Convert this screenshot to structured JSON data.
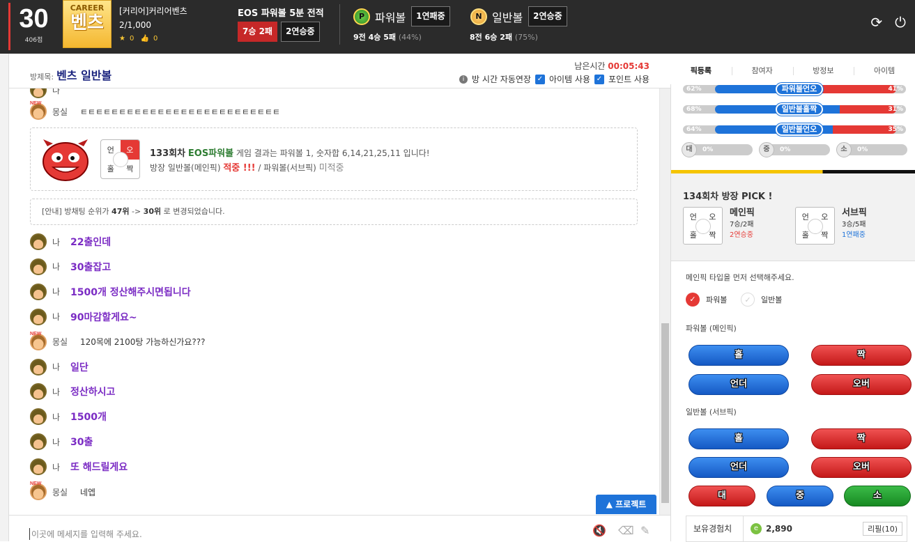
{
  "top": {
    "level": "30",
    "points": "406점",
    "badge_top": "CAREER",
    "badge_main": "벤츠",
    "user_name": "[커리어]커리어벤츠",
    "user_count": "2/1,000",
    "stars": "0",
    "likes": "0",
    "game_title": "EOS 파워볼 5분 전적",
    "record_tag": "7승 2패",
    "streak_tag": "2연승중",
    "powerball": {
      "coin": "P",
      "label": "파워볼",
      "streak": "1연패중",
      "record": "9전 4승 5패",
      "rate": "(44%)"
    },
    "normalball": {
      "coin": "N",
      "label": "일반볼",
      "streak": "2연승중",
      "record": "8전 6승 2패",
      "rate": "(75%)"
    },
    "refresh_icon": "refresh-icon",
    "power_icon": "power-icon"
  },
  "room": {
    "title_label": "방제목:",
    "title": "벤츠 일반볼",
    "remain_label": "남은시간",
    "remain_time": "00:05:43",
    "auto_extend": "방 시간 자동연장",
    "use_item": "아이템 사용",
    "use_point": "포인트 사용"
  },
  "chat": {
    "top_partial_name": "나",
    "m1_name": "몽실",
    "m1_text": "ㅌㅌㅌㅌㅌㅌㅌㅌㅌㅌㅌㅌㅌㅌㅌㅌㅌㅌㅌㅌㅌㅌㅌㅌㅌㅌ",
    "result": {
      "dial": [
        "언",
        "오",
        "홀",
        "짝"
      ],
      "round": "133회차",
      "game": "EOS파워볼",
      "text1": "게임 결과는 파워볼 1, 숫자합 6,14,21,25,11 입니다!",
      "text2a": "방장 일반볼(메인픽)",
      "hit": "적중 !!!",
      "text2b": "/ 파워볼(서브픽)",
      "miss": "미적중"
    },
    "notice_pre": "[안내] 방채팅 순위가",
    "notice_from": "47위",
    "notice_mid": "->",
    "notice_to": "30위",
    "notice_post": "로 변경되었습니다.",
    "messages": [
      {
        "who": "나",
        "text": "22출인데"
      },
      {
        "who": "나",
        "text": "30출잡고"
      },
      {
        "who": "나",
        "text": "1500개 정산해주시면됩니다"
      },
      {
        "who": "나",
        "text": "90마감할게요~"
      },
      {
        "who": "몽실",
        "text": "120목에 2100탕 가능하신가요???"
      },
      {
        "who": "나",
        "text": "일단"
      },
      {
        "who": "나",
        "text": "정산하시고"
      },
      {
        "who": "나",
        "text": "1500개"
      },
      {
        "who": "나",
        "text": "30출"
      },
      {
        "who": "나",
        "text": "또 해드릴게요"
      },
      {
        "who": "몽실",
        "text": "네엡"
      }
    ],
    "new_label": "NEW",
    "protect_label": "▲ 프로젝트",
    "input_placeholder": "이곳에 메세지를 입력해 주세요."
  },
  "right": {
    "tabs": [
      "픽등록",
      "참여자",
      "방정보",
      "아이템"
    ],
    "bars": [
      {
        "left": "62%",
        "label": "파워볼언오",
        "right": "41%",
        "left_frac": 0.59
      },
      {
        "left": "68%",
        "label": "일반볼홀짝",
        "right": "31%",
        "left_frac": 0.69
      },
      {
        "left": "64%",
        "label": "일반볼언오",
        "right": "35%",
        "left_frac": 0.65
      }
    ],
    "size_bars": [
      {
        "icon": "대",
        "value": "0%"
      },
      {
        "icon": "중",
        "value": "0%"
      },
      {
        "icon": "소",
        "value": "0%"
      }
    ],
    "pick_title": "134회차 방장 PICK !",
    "main_pick": {
      "dial": [
        "언",
        "오",
        "홀",
        "짝"
      ],
      "title": "메인픽",
      "record": "7승/2패",
      "streak": "2연승중"
    },
    "sub_pick": {
      "dial": [
        "언",
        "오",
        "홀",
        "짝"
      ],
      "title": "서브픽",
      "record": "3승/5패",
      "streak": "1연패중"
    },
    "instruction": "메인픽 타입을 먼저 선택해주세요.",
    "radio_power": "파워볼",
    "radio_normal": "일반볼",
    "power_section": "파워볼 (메인픽)",
    "normal_section": "일반볼 (서브픽)",
    "btn_odd": "홀",
    "btn_even": "짝",
    "btn_under": "언더",
    "btn_over": "오버",
    "btn_big": "대",
    "btn_mid": "중",
    "btn_small": "소",
    "exp_label": "보유경험치",
    "exp_icon": "e",
    "exp_value": "2,890",
    "refill": "리필(10)"
  }
}
